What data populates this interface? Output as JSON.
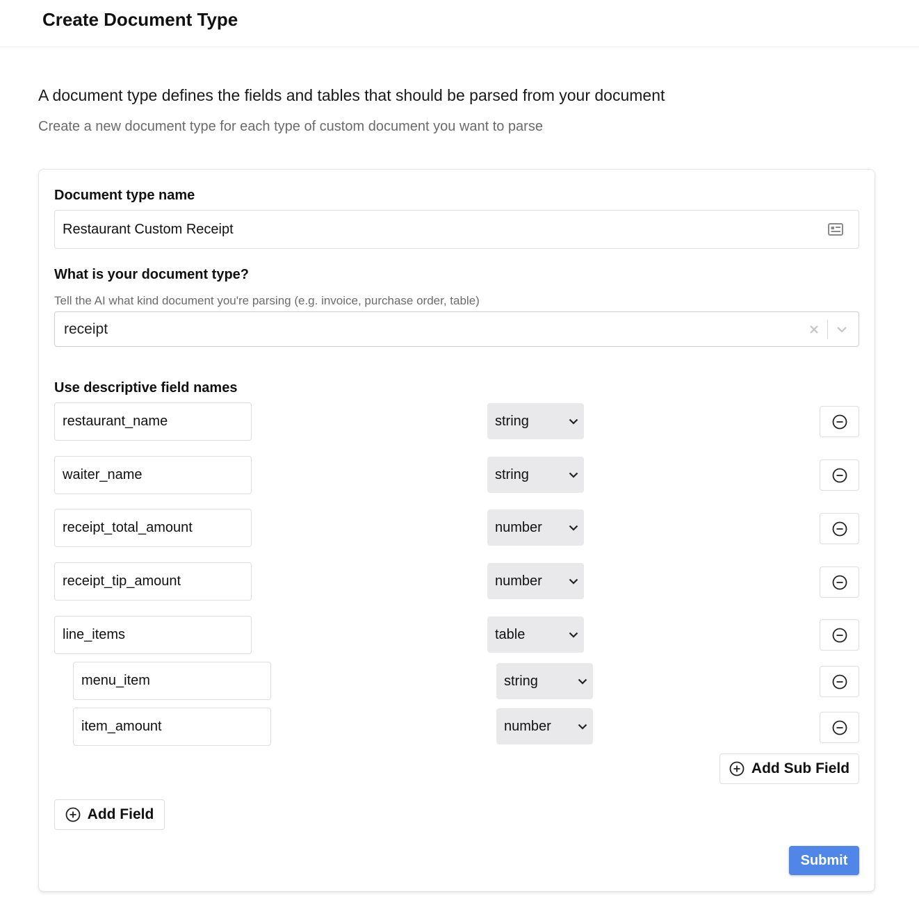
{
  "header": {
    "title": "Create Document Type"
  },
  "intro": {
    "title": "A document type defines the fields and tables that should be parsed from your document",
    "subtitle": "Create a new document type for each type of custom document you want to parse"
  },
  "form": {
    "name_label": "Document type name",
    "name_value": "Restaurant Custom Receipt",
    "doc_type_label": "What is your document type?",
    "doc_type_hint": "Tell the AI what kind document you're parsing (e.g. invoice, purchase order, table)",
    "doc_type_value": "receipt",
    "fields_label": "Use descriptive field names",
    "fields": [
      {
        "name": "restaurant_name",
        "type": "string"
      },
      {
        "name": "waiter_name",
        "type": "string"
      },
      {
        "name": "receipt_total_amount",
        "type": "number"
      },
      {
        "name": "receipt_tip_amount",
        "type": "number"
      },
      {
        "name": "line_items",
        "type": "table"
      }
    ],
    "sub_fields": [
      {
        "name": "menu_item",
        "type": "string"
      },
      {
        "name": "item_amount",
        "type": "number"
      }
    ],
    "add_sub_field_label": "Add Sub Field",
    "add_field_label": "Add Field",
    "submit_label": "Submit"
  },
  "icons": {
    "name_input": "id-card-icon",
    "clear": "close-icon",
    "dropdown": "chevron-down-icon",
    "remove": "minus-circle-icon",
    "add": "plus-circle-icon"
  },
  "colors": {
    "primary": "#4f86e8",
    "select_bg": "#e9e9eb",
    "muted_text": "#6b6b6b"
  }
}
